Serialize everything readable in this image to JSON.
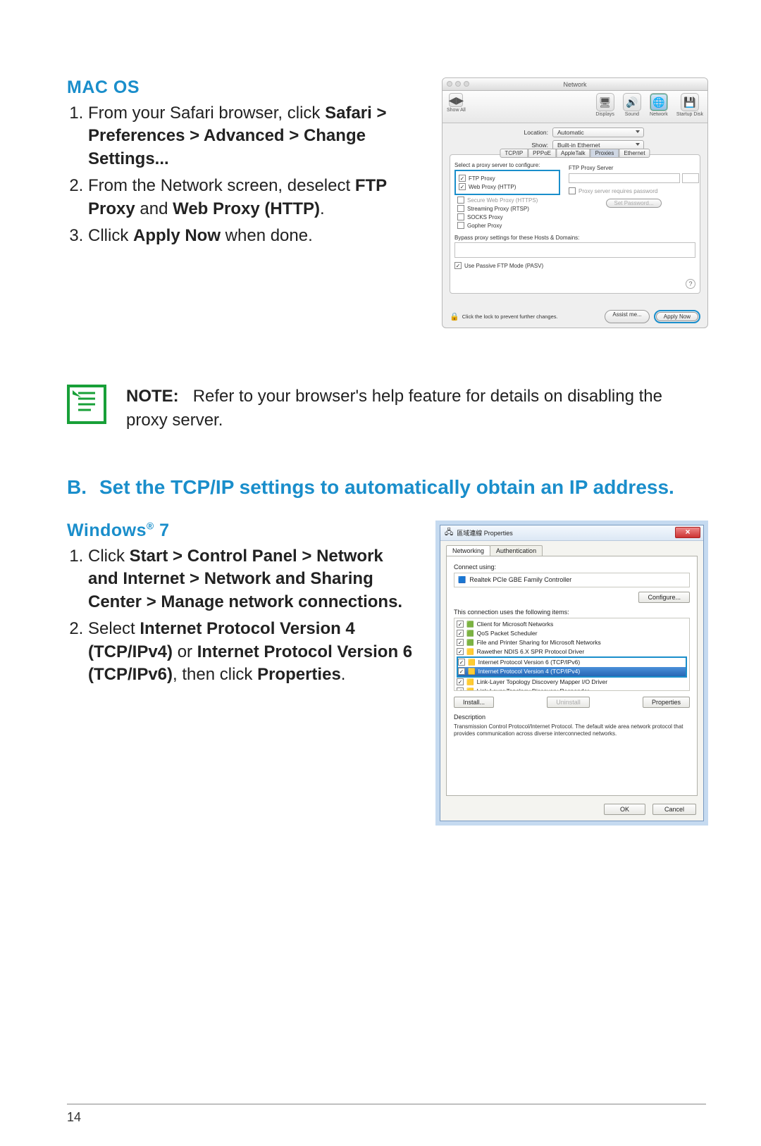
{
  "macos": {
    "heading": "MAC OS",
    "step1": {
      "pre": "From your Safari browser, click ",
      "b": "Safari > Preferences > Advanced > Change Settings..."
    },
    "step2": {
      "pre": "From the Network screen, deselect ",
      "b1": "FTP Proxy",
      "mid": " and ",
      "b2": "Web Proxy (HTTP)",
      "post": "."
    },
    "step3": {
      "pre": "Cllick ",
      "b": "Apply Now",
      "post": " when done."
    }
  },
  "macwin": {
    "title": "Network",
    "toolbar": {
      "showAll": "Show All",
      "displays": "Displays",
      "sound": "Sound",
      "network": "Network",
      "startup": "Startup Disk"
    },
    "location_lbl": "Location:",
    "location_val": "Automatic",
    "show_lbl": "Show:",
    "show_val": "Built-in Ethernet",
    "tabs": [
      "TCP/IP",
      "PPPoE",
      "AppleTalk",
      "Proxies",
      "Ethernet"
    ],
    "config_lbl": "Select a proxy server to configure:",
    "ftp_server_lbl": "FTP Proxy Server",
    "proxies": {
      "ftp": "FTP Proxy",
      "web": "Web Proxy (HTTP)",
      "secure": "Secure Web Proxy (HTTPS)",
      "stream": "Streaming Proxy (RTSP)",
      "socks": "SOCKS Proxy",
      "gopher": "Gopher Proxy"
    },
    "pwd_chk": "Proxy server requires password",
    "set_pwd": "Set Password...",
    "bypass": "Bypass proxy settings for these Hosts & Domains:",
    "passive": "Use Passive FTP Mode (PASV)",
    "lock": "Click the lock to prevent further changes.",
    "assist": "Assist me...",
    "apply": "Apply Now"
  },
  "note": {
    "label": "NOTE:",
    "text": "Refer to your browser's help feature for details on disabling the proxy server."
  },
  "sectionB": {
    "letter": "B.",
    "title": "Set the TCP/IP settings to automatically obtain an IP address."
  },
  "win7": {
    "heading_pre": "Windows",
    "heading_sup": "®",
    "heading_ver": " 7",
    "step1": {
      "pre": "Click ",
      "b": "Start > Control Panel > Network and Internet > Network and Sharing Center > Manage network connections."
    },
    "step2": {
      "pre": "Select ",
      "b1": "Internet Protocol Version 4 (TCP/IPv4)",
      "mid": " or ",
      "b2": "Internet Protocol Version 6 (TCP/IPv6)",
      "post": ", then click ",
      "b3": "Properties",
      "end": "."
    }
  },
  "winwin": {
    "title": "區域連線 Properties",
    "tabs": {
      "net": "Networking",
      "auth": "Authentication"
    },
    "connect_lbl": "Connect using:",
    "adapter": "Realtek PCIe GBE Family Controller",
    "configure": "Configure...",
    "items_lbl": "This connection uses the following items:",
    "items": {
      "cli": "Client for Microsoft Networks",
      "qos": "QoS Packet Scheduler",
      "fps": "File and Printer Sharing for Microsoft Networks",
      "raw": "Rawether NDIS 6.X SPR Protocol Driver",
      "v6": "Internet Protocol Version 6 (TCP/IPv6)",
      "v4": "Internet Protocol Version 4 (TCP/IPv4)",
      "lltd": "Link-Layer Topology Discovery Mapper I/O Driver",
      "lltr": "Link-Layer Topology Discovery Responder"
    },
    "install": "Install...",
    "uninstall": "Uninstall",
    "properties": "Properties",
    "desc_lbl": "Description",
    "desc": "Transmission Control Protocol/Internet Protocol. The default wide area network protocol that provides communication across diverse interconnected networks.",
    "ok": "OK",
    "cancel": "Cancel"
  },
  "page_number": "14"
}
